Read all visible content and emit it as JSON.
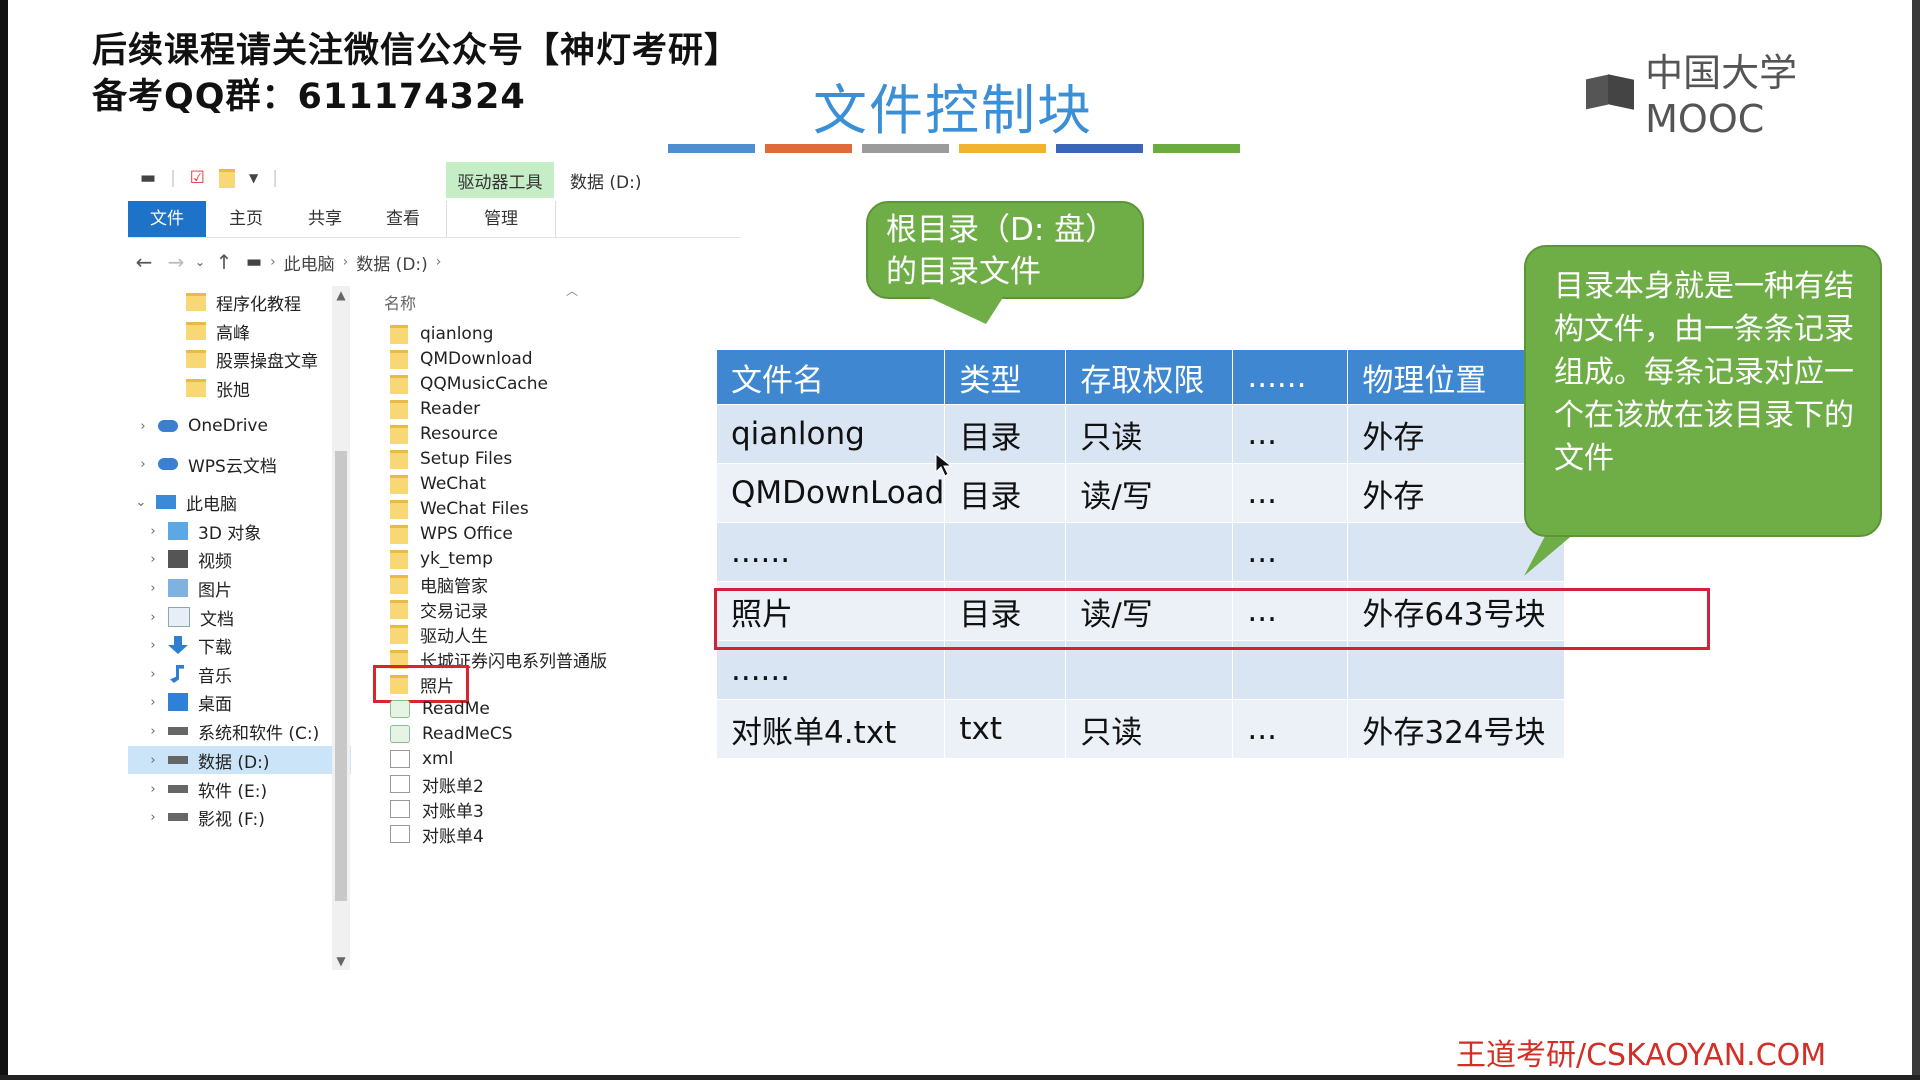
{
  "header": {
    "line1": "后续课程请关注微信公众号【神灯考研】",
    "line2": "备考QQ群：611174324"
  },
  "slide": {
    "title": "文件控制块",
    "logo_text": "中国大学MOOC",
    "watermark": "王道考研/CSKAOYAN.COM",
    "color_bar": [
      "#4f8fd0",
      "#e06a3a",
      "#9b9b9b",
      "#f2b430",
      "#3b66b8",
      "#6cab3f"
    ]
  },
  "explorer": {
    "drive_tools": "驱动器工具",
    "drive_title": "数据 (D:)",
    "tabs": [
      {
        "label": "文件"
      },
      {
        "label": "主页"
      },
      {
        "label": "共享"
      },
      {
        "label": "查看"
      },
      {
        "label": "管理"
      }
    ],
    "breadcrumb": [
      "此电脑",
      "数据 (D:)"
    ],
    "tree": [
      {
        "label": "程序化教程",
        "icon": "folder-icon"
      },
      {
        "label": "高峰",
        "icon": "folder-icon"
      },
      {
        "label": "股票操盘文章",
        "icon": "folder-icon"
      },
      {
        "label": "张旭",
        "icon": "folder-icon"
      },
      {
        "label": "OneDrive",
        "icon": "cloud-icon"
      },
      {
        "label": "WPS云文档",
        "icon": "cloud-icon"
      },
      {
        "label": "此电脑",
        "icon": "computer-icon"
      },
      {
        "label": "3D 对象",
        "icon": "cube-icon"
      },
      {
        "label": "视频",
        "icon": "video-icon"
      },
      {
        "label": "图片",
        "icon": "picture-icon"
      },
      {
        "label": "文档",
        "icon": "document-icon"
      },
      {
        "label": "下载",
        "icon": "download-icon"
      },
      {
        "label": "音乐",
        "icon": "music-icon"
      },
      {
        "label": "桌面",
        "icon": "desktop-icon"
      },
      {
        "label": "系统和软件 (C:)",
        "icon": "drive-icon"
      },
      {
        "label": "数据 (D:)",
        "icon": "drive-icon"
      },
      {
        "label": "软件 (E:)",
        "icon": "drive-icon"
      },
      {
        "label": "影视 (F:)",
        "icon": "drive-icon"
      }
    ],
    "column_header": "名称",
    "files": [
      {
        "name": "qianlong",
        "kind": "folder"
      },
      {
        "name": "QMDownload",
        "kind": "folder"
      },
      {
        "name": "QQMusicCache",
        "kind": "folder"
      },
      {
        "name": "Reader",
        "kind": "folder"
      },
      {
        "name": "Resource",
        "kind": "folder"
      },
      {
        "name": "Setup Files",
        "kind": "folder"
      },
      {
        "name": "WeChat",
        "kind": "folder"
      },
      {
        "name": "WeChat Files",
        "kind": "folder"
      },
      {
        "name": "WPS Office",
        "kind": "folder"
      },
      {
        "name": "yk_temp",
        "kind": "folder"
      },
      {
        "name": "电脑管家",
        "kind": "folder"
      },
      {
        "name": "交易记录",
        "kind": "folder"
      },
      {
        "name": "驱动人生",
        "kind": "folder"
      },
      {
        "name": "长城证券闪电系列普通版",
        "kind": "folder"
      },
      {
        "name": "照片",
        "kind": "folder"
      },
      {
        "name": "ReadMe",
        "kind": "exe"
      },
      {
        "name": "ReadMeCS",
        "kind": "exe"
      },
      {
        "name": "xml",
        "kind": "doc"
      },
      {
        "name": "对账单2",
        "kind": "doc"
      },
      {
        "name": "对账单3",
        "kind": "doc"
      },
      {
        "name": "对账单4",
        "kind": "doc"
      }
    ]
  },
  "table": {
    "headers": [
      "文件名",
      "类型",
      "存取权限",
      "......",
      "物理位置"
    ],
    "rows": [
      [
        "qianlong",
        "目录",
        "只读",
        "...",
        "外存"
      ],
      [
        "QMDownLoad",
        "目录",
        "读/写",
        "...",
        "外存"
      ],
      [
        "......",
        "",
        "",
        "...",
        ""
      ],
      [
        "照片",
        "目录",
        "读/写",
        "...",
        "外存643号块"
      ],
      [
        "......",
        "",
        "",
        "",
        ""
      ],
      [
        "对账单4.txt",
        "txt",
        "只读",
        "...",
        "外存324号块"
      ]
    ]
  },
  "callouts": {
    "root": "根目录（D: 盘）的目录文件",
    "explain": "目录本身就是一种有结构文件，由一条条记录组成。每条记录对应一个在该放在该目录下的文件"
  }
}
